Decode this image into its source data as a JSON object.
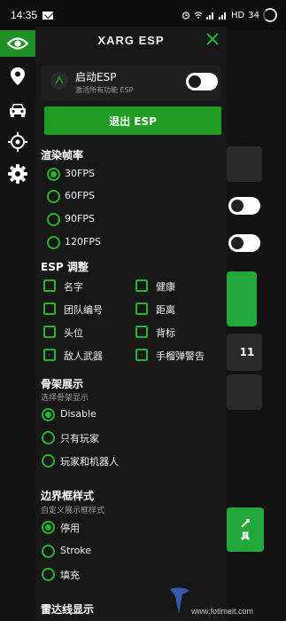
{
  "status_bar": {
    "time": "14:35",
    "network": "HD",
    "battery": "34"
  },
  "panel": {
    "title": "XARG ESP",
    "esp_card": {
      "title": "启动ESP",
      "subtitle": "激活所有功能 ESP",
      "enabled": false
    },
    "exit_button": "退出 ESP",
    "framerate": {
      "title": "渲染帧率",
      "options": [
        "30FPS",
        "60FPS",
        "90FPS",
        "120FPS"
      ],
      "selected": "30FPS"
    },
    "esp_adjust": {
      "title": "ESP 调整",
      "left": [
        "名字",
        "团队编号",
        "头位",
        "敌人武器"
      ],
      "right": [
        "健康",
        "距离",
        "背标",
        "手榴弹警告"
      ]
    },
    "skeleton": {
      "title": "骨架展示",
      "subtitle": "选择骨架显示",
      "options": [
        "Disable",
        "只有玩家",
        "玩家和机器人"
      ],
      "selected": "Disable"
    },
    "box_style": {
      "title": "边界框样式",
      "subtitle": "自定义展示框样式",
      "options": [
        "停用",
        "Stroke",
        "填充"
      ],
      "selected": "停用"
    },
    "radar": {
      "title": "雷达线显示"
    }
  },
  "background": {
    "number_text": "11",
    "tool_text": "具"
  },
  "watermark": {
    "text": "www.fotimeit.com"
  },
  "colors": {
    "accent": "#23b52b",
    "button": "#1f9d22",
    "panel": "#171717"
  }
}
